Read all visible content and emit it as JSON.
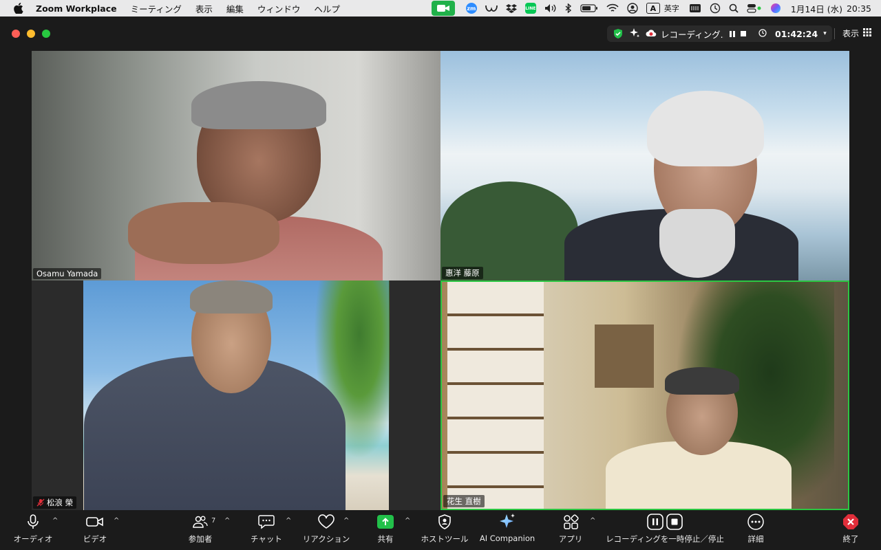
{
  "menubar": {
    "app_name": "Zoom Workplace",
    "menus": [
      "ミーティング",
      "表示",
      "編集",
      "ウィンドウ",
      "ヘルプ"
    ],
    "ime_label": "英字",
    "input_mode_glyph": "A",
    "zm_icon_text": "zm",
    "line_icon_text": "LINE",
    "date": "1月14日 (水)",
    "time": "20:35"
  },
  "meeting": {
    "recording_label": "レコーディング...",
    "timer": "01:42:24",
    "view_label": "表示"
  },
  "participants": [
    {
      "name": "Osamu Yamada",
      "muted": false
    },
    {
      "name": "惠洋 藤原",
      "muted": false
    },
    {
      "name": "松浪 榮",
      "muted": true
    },
    {
      "name": "花生 直樹",
      "muted": false,
      "active_speaker": true
    }
  ],
  "toolbar": {
    "audio": "オーディオ",
    "video": "ビデオ",
    "participants": "参加者",
    "participants_count": "7",
    "chat": "チャット",
    "reactions": "リアクション",
    "share": "共有",
    "host_tools": "ホストツール",
    "ai_companion": "AI Companion",
    "apps": "アプリ",
    "recording_control": "レコーディングを一時停止／停止",
    "more": "詳細",
    "end": "終了"
  },
  "colors": {
    "share_green": "#22c04a",
    "active_border": "#2bc742",
    "end_red": "#e02e3a"
  }
}
